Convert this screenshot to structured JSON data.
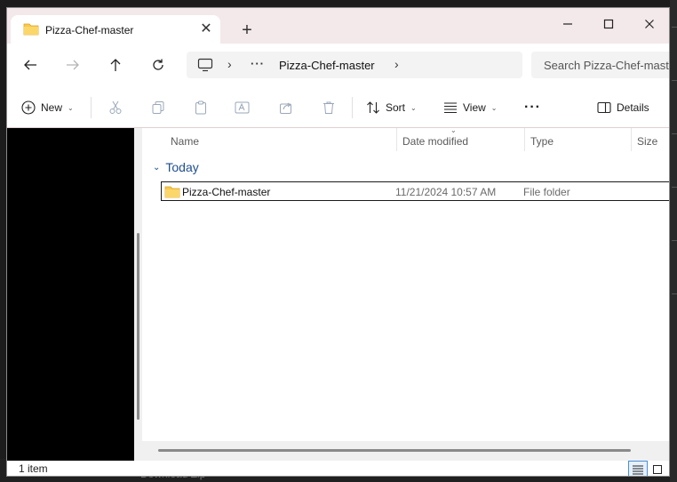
{
  "window": {
    "tab_title": "Pizza-Chef-master",
    "tab_close_glyph": "✕",
    "new_tab_glyph": "+"
  },
  "address": {
    "dots": "···",
    "crumb": "Pizza-Chef-master",
    "separator": "›"
  },
  "search": {
    "placeholder": "Search Pizza-Chef-master"
  },
  "toolbar": {
    "new_label": "New",
    "sort_label": "Sort",
    "view_label": "View",
    "more_glyph": "···",
    "details_label": "Details",
    "chevron": "⌄"
  },
  "columns": {
    "name": "Name",
    "date_modified": "Date modified",
    "type": "Type",
    "size": "Size",
    "sort_caret": "⌄"
  },
  "groups": [
    {
      "title": "Today",
      "chevron": "⌄",
      "items": [
        {
          "name": "Pizza-Chef-master",
          "date_modified": "11/21/2024 10:57 AM",
          "type": "File folder",
          "size": "",
          "icon": "folder-icon"
        }
      ]
    }
  ],
  "status": {
    "item_count": "1 item"
  },
  "background": {
    "ghost_text": "Download Zip"
  },
  "colors": {
    "accent": "#1f4e8f",
    "folder": "#f8c84a",
    "titlebar": "#f3e9ea"
  }
}
